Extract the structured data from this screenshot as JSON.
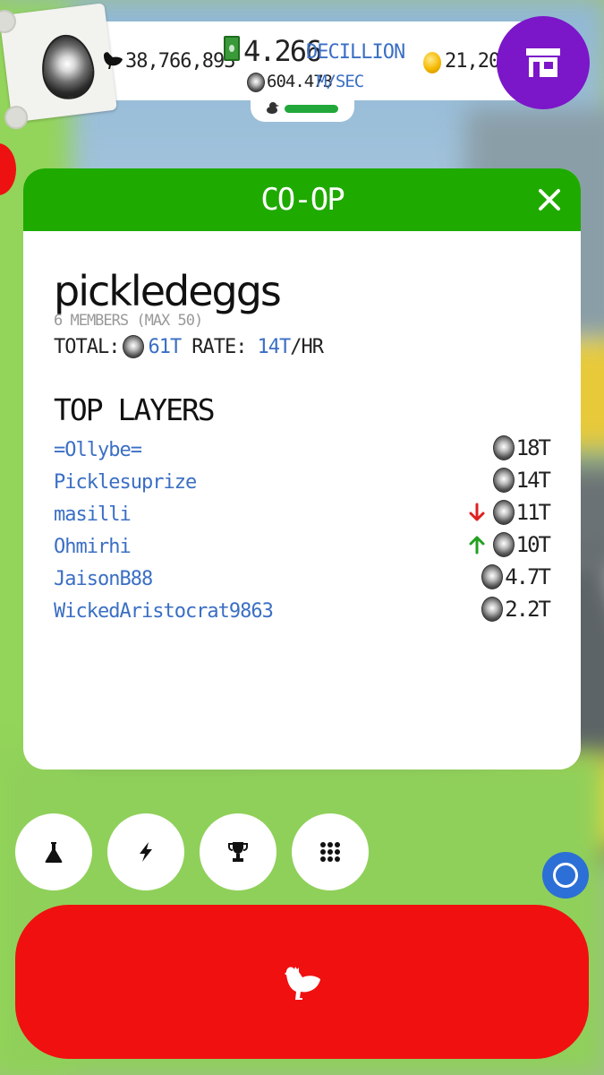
{
  "hud": {
    "chicken_count": "38,766,893",
    "cash_amount": "4.266",
    "cash_unit": "DECILLION",
    "earning_rate": "604.473",
    "earning_rate_unit": "M/SEC",
    "golden_eggs": "21,202",
    "colors": {
      "shop": "#7b16c9",
      "accent_blue": "#3b6fc4",
      "hatch_bar": "#22a83a"
    }
  },
  "panel": {
    "title": "CO-OP",
    "coop_name": "pickledeggs",
    "members_text": "6 MEMBERS (MAX 50)",
    "total_label": "TOTAL:",
    "total_value": "61T",
    "rate_label": "RATE:",
    "rate_value": "14T",
    "rate_unit": "/HR",
    "section_title": "TOP LAYERS",
    "header_color": "#1faa00",
    "players": [
      {
        "name": "=Ollybe=",
        "value": "18T",
        "trend": "none"
      },
      {
        "name": "Picklesuprize",
        "value": "14T",
        "trend": "none"
      },
      {
        "name": "masilli",
        "value": "11T",
        "trend": "down"
      },
      {
        "name": "Ohmirhi",
        "value": "10T",
        "trend": "up"
      },
      {
        "name": "JaisonB88",
        "value": "4.7T",
        "trend": "none"
      },
      {
        "name": "WickedAristocrat9863",
        "value": "2.2T",
        "trend": "none"
      }
    ]
  },
  "bottom": {
    "buttons": [
      "flask-icon",
      "lightning-icon",
      "trophy-icon",
      "grid-icon"
    ],
    "hatch_color": "#f01010"
  }
}
